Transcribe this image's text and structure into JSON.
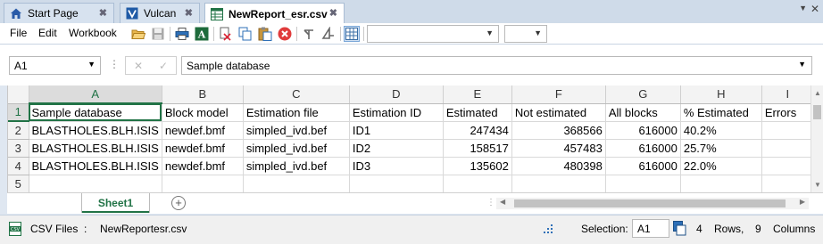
{
  "tabs": [
    {
      "label": "Start Page",
      "icon": "home-icon",
      "active": false
    },
    {
      "label": "Vulcan",
      "icon": "vulcan-icon",
      "active": false
    },
    {
      "label": "NewReport_esr.csv",
      "icon": "spreadsheet-icon",
      "active": true
    }
  ],
  "tab_close_glyph": "✖",
  "tabstrip": {
    "menu_glyph": "▼",
    "close_glyph": "✕"
  },
  "menu": {
    "file": "File",
    "edit": "Edit",
    "workbook": "Workbook"
  },
  "formula_bar": {
    "cell_ref": "A1",
    "content": "Sample database",
    "cancel": "✕",
    "confirm": "✓"
  },
  "columns": [
    "A",
    "B",
    "C",
    "D",
    "E",
    "F",
    "G",
    "H",
    "I"
  ],
  "rows": [
    {
      "num": "1",
      "cells": [
        "Sample database",
        "Block model",
        "Estimation file",
        "Estimation ID",
        "Estimated",
        "Not estimated",
        "All blocks",
        "% Estimated",
        "Errors"
      ]
    },
    {
      "num": "2",
      "cells": [
        "BLASTHOLES.BLH.ISIS",
        "newdef.bmf",
        "simpled_ivd.bef",
        "ID1",
        "247434",
        "368566",
        "616000",
        "40.2%",
        ""
      ]
    },
    {
      "num": "3",
      "cells": [
        "BLASTHOLES.BLH.ISIS",
        "newdef.bmf",
        "simpled_ivd.bef",
        "ID2",
        "158517",
        "457483",
        "616000",
        "25.7%",
        ""
      ]
    },
    {
      "num": "4",
      "cells": [
        "BLASTHOLES.BLH.ISIS",
        "newdef.bmf",
        "simpled_ivd.bef",
        "ID3",
        "135602",
        "480398",
        "616000",
        "22.0%",
        ""
      ]
    },
    {
      "num": "5",
      "cells": [
        "",
        "",
        "",
        "",
        "",
        "",
        "",
        "",
        ""
      ]
    }
  ],
  "sheet": {
    "name": "Sheet1",
    "add": "+"
  },
  "status": {
    "file_type": "CSV Files",
    "separator": ":",
    "file_name": "NewReportesr.csv",
    "selection_label": "Selection:",
    "selection_value": "A1",
    "rows_count": "4",
    "rows_label": "Rows,",
    "columns_count": "9",
    "columns_label": "Columns"
  },
  "colors": {
    "accent": "#217346",
    "tab_bg": "#cfdbe9",
    "delete": "#e03b3b"
  }
}
